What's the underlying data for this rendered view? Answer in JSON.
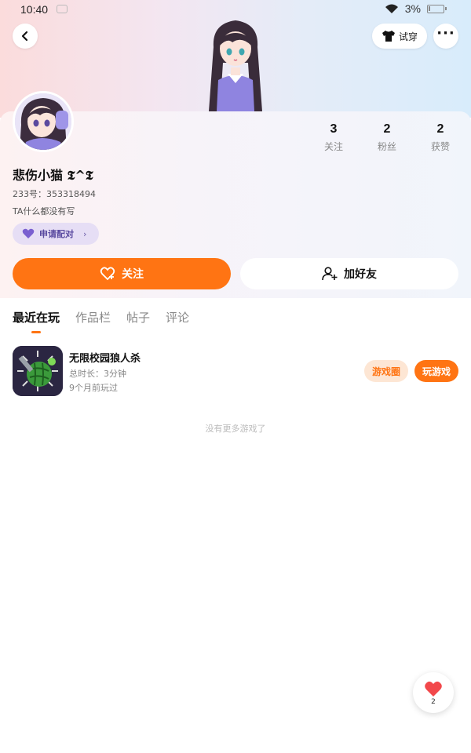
{
  "status_bar": {
    "time": "10:40",
    "battery_percent": "3%"
  },
  "header": {
    "try_on_label": "试穿",
    "back_icon": "chevron-left-icon",
    "more_icon": "more-dots-icon"
  },
  "profile": {
    "username": "悲伤小猫 𝕿^𝕿",
    "user_id": "233号：353318494",
    "bio": "TA什么都没有写",
    "pair_label": "申请配对",
    "stats": [
      {
        "value": "3",
        "label": "关注"
      },
      {
        "value": "2",
        "label": "粉丝"
      },
      {
        "value": "2",
        "label": "获赞"
      }
    ]
  },
  "actions": {
    "follow_label": "关注",
    "add_friend_label": "加好友"
  },
  "tabs": [
    {
      "label": "最近在玩",
      "active": true
    },
    {
      "label": "作品栏",
      "active": false
    },
    {
      "label": "帖子",
      "active": false
    },
    {
      "label": "评论",
      "active": false
    }
  ],
  "games": [
    {
      "title": "无限校园狼人杀",
      "duration": "总时长：3分钟",
      "last_played": "9个月前玩过",
      "circle_label": "游戏圈",
      "play_label": "玩游戏"
    }
  ],
  "no_more_text": "没有更多游戏了",
  "like": {
    "count": "2"
  },
  "colors": {
    "accent": "#ff7413",
    "pair_bg": "#e6def5",
    "pair_text": "#5a4aa0"
  }
}
